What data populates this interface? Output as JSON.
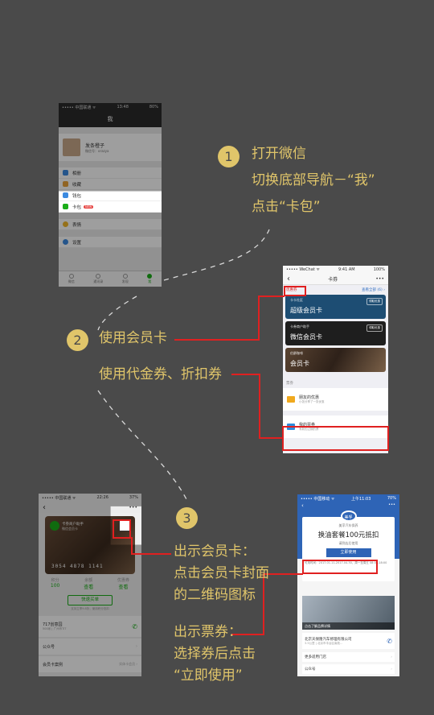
{
  "colors": {
    "background": "#4a4a4a",
    "accent_text": "#e0c56a",
    "highlight_red": "#e02020",
    "wechat_green": "#1aad19",
    "mobil_blue": "#2e64b6"
  },
  "steps": [
    {
      "number": "1",
      "lines": [
        "打开微信",
        "切换底部导航－“我”",
        "点击“卡包”"
      ]
    },
    {
      "number": "2",
      "lines": [
        "使用会员卡"
      ],
      "extra": "使用代金券、折扣券"
    },
    {
      "number": "3",
      "show_card_lines": [
        "出示会员卡：",
        "点击会员卡封面",
        "的二维码图标"
      ],
      "show_ticket_lines": [
        "出示票券：",
        "选择券后点击",
        "“立即使用”"
      ]
    }
  ],
  "phone1": {
    "status_left": "••••• 中国联通 ᯤ",
    "status_center": "13:48",
    "status_right": "80%",
    "title": "我",
    "profile_name": "发条橙子",
    "profile_id": "微信号：orazya",
    "menu": [
      {
        "label": "相册",
        "color": "#3c8ae0"
      },
      {
        "label": "收藏",
        "color": "#e8a23a"
      },
      {
        "label": "钱包",
        "color": "#3c8ae0"
      },
      {
        "label": "卡包",
        "color": "#1aad19",
        "badge": "NEW"
      },
      {
        "label": "表情",
        "color": "#f0b62a"
      },
      {
        "label": "设置",
        "color": "#3c8ae0"
      }
    ],
    "tabs": [
      "微信",
      "通讯录",
      "发现",
      "我"
    ]
  },
  "phone2": {
    "status_left": "••••• WeChat ᯤ",
    "status_center": "9:41 AM",
    "status_right": "100%",
    "back": "‹",
    "title": "卡券",
    "more": "•••",
    "section1": "优惠券",
    "view_all": "查看全部 (6) ›",
    "cards": [
      {
        "brand": "卡卡社区",
        "name": "超级会员卡",
        "tag": "领取优惠",
        "bg": "#1d4d73"
      },
      {
        "brand": "卡券商户助手",
        "name": "微信会员卡",
        "tag": "领取优惠",
        "bg": "#1e1e1e"
      },
      {
        "brand": "伯爵咖啡",
        "name": "会员卡",
        "tag": "",
        "bg": "#5a4432"
      }
    ],
    "section2": "票券",
    "rows": [
      {
        "title": "朋友的优惠",
        "sub": "小张分享了一张优惠",
        "color": "#f0a91e"
      },
      {
        "title": "我的票券",
        "sub": "有新的过期的票",
        "color": "#2e8bdc"
      }
    ]
  },
  "phone3": {
    "status_left": "••••• 中国联通 ᯤ",
    "status_center": "22:26",
    "status_right": "37%",
    "back": "‹",
    "more": "•••",
    "card_brand": "卡券商户助手",
    "card_sub": "微信会员卡",
    "card_number": "3054 4878 1141",
    "stats": [
      {
        "label": "积分",
        "value": "100"
      },
      {
        "label": "余额",
        "value": "查看"
      },
      {
        "label": "优惠券",
        "value": "查看"
      }
    ],
    "quick_pay": "快速买单",
    "quick_pay_note": "支持立享9.8折，使用积分抵扣",
    "store_name": "717创意园",
    "store_addr": "500米 | 广州市TIT",
    "rows": [
      "公众号",
      "会员卡案例"
    ],
    "row_hint": "实体卡会员 ›"
  },
  "phone4": {
    "status_left": "••••• 中国移动 ᯤ",
    "status_center": "上午11:03",
    "status_right": "70%",
    "back": "‹",
    "more": "•••",
    "logo": "美孚",
    "shop_small": "美孚汽车保养",
    "offer": "换油套餐100元抵扣",
    "offer_sub": "请到店后使用",
    "use_now": "立即使用",
    "valid": "可用时间：2017.01.11-2017.04.30，周一至周五 08:00-18:00",
    "photo_caption": "点击了解品牌详情",
    "shop_name": "北京天保隆汽车修理有限公司",
    "shop_addr": "3.5公里 | 北京市丰台区南苑…",
    "rows": [
      "更多适用门店",
      "公众号"
    ]
  }
}
